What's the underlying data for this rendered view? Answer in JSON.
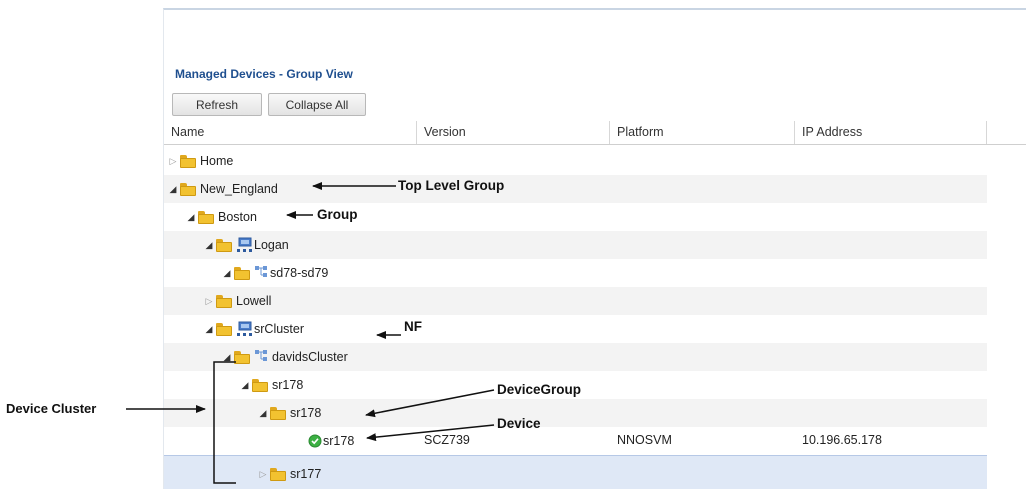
{
  "panel": {
    "title": "Managed Devices - Group View",
    "buttons": {
      "refresh": "Refresh",
      "collapse_all": "Collapse All"
    },
    "columns": [
      "Name",
      "Version",
      "Platform",
      "IP Address"
    ]
  },
  "tree": [
    {
      "label": "Home",
      "icon": "folder-icon",
      "expanded": false
    },
    {
      "label": "New_England",
      "icon": "folder-icon",
      "expanded": true
    },
    {
      "label": "Boston",
      "icon": "folder-icon",
      "expanded": true
    },
    {
      "label": "Logan",
      "icon": "network-function-icon",
      "expanded": true
    },
    {
      "label": "sd78-sd79",
      "icon": "device-cluster-icon",
      "expanded": true
    },
    {
      "label": "Lowell",
      "icon": "folder-icon",
      "expanded": false
    },
    {
      "label": "srCluster",
      "icon": "network-function-icon",
      "expanded": true
    },
    {
      "label": "davidsCluster",
      "icon": "device-cluster-icon",
      "expanded": true
    },
    {
      "label": "sr178",
      "icon": "folder-icon",
      "expanded": true
    },
    {
      "label": "sr178",
      "icon": "folder-icon",
      "expanded": true
    },
    {
      "label": "sr178",
      "icon": "device-status-green-icon",
      "version": "SCZ739",
      "platform": "NNOSVM",
      "ip": "10.196.65.178"
    },
    {
      "label": "sr177",
      "icon": "folder-icon",
      "expanded": false
    }
  ],
  "annotations": {
    "top_level_group": "Top Level Group",
    "group": "Group",
    "nf": "NF",
    "device_group": "DeviceGroup",
    "device": "Device",
    "device_cluster": "Device Cluster"
  },
  "colors": {
    "title": "#1f4f8f",
    "folder": "#f2c230",
    "selected_row": "#dfe8f6",
    "status_green": "#3cb043"
  }
}
